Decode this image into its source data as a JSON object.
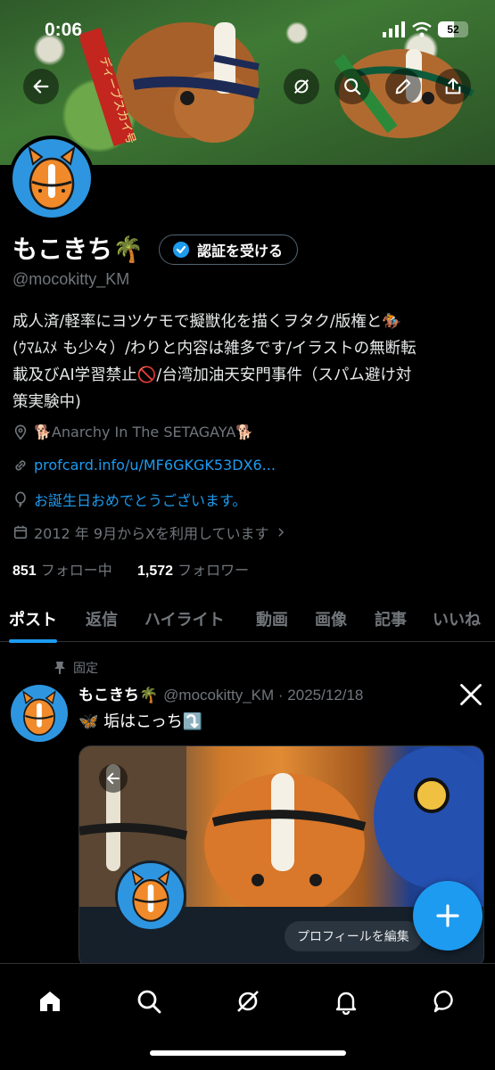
{
  "status_bar": {
    "time": "0:06",
    "battery": "52"
  },
  "banner": {
    "sash_text": "ディープスカイ号",
    "icons": [
      "back-arrow-icon",
      "grok-icon",
      "search-icon",
      "edit-pencil-icon",
      "share-icon"
    ]
  },
  "profile": {
    "name": "もこきち🌴",
    "verify_label": "認証を受ける",
    "handle": "@mocokitty_KM",
    "bio_lines": [
      "成人済/軽率にヨツケモで擬獣化を描くヲタク/版権と🏇",
      "(ｳﾏﾑｽﾒ も少々）/わりと内容は雑多です/イラストの無断転",
      "載及びAI学習禁止🚫/台湾加油天安門事件（スパム避け対",
      "策実験中)"
    ],
    "location": "🐕Anarchy In The SETAGAYA🐕",
    "link": "profcard.info/u/MF6GKGK53DX6...",
    "birthday": "お誕生日おめでとうございます。",
    "joined": "2012 年 9月からXを利用しています",
    "following_count": "851",
    "following_label": "フォロー中",
    "followers_count": "1,572",
    "followers_label": "フォロワー"
  },
  "tabs": [
    "ポスト",
    "返信",
    "ハイライト",
    "動画",
    "画像",
    "記事",
    "いいね"
  ],
  "post": {
    "pinned_label": "固定",
    "author": "もこきち🌴",
    "handle_date": "@mocokitty_KM · 2025/12/18",
    "text": "🦋 垢はこっち⤵️",
    "media_button": "プロフィールを編集"
  },
  "colors": {
    "accent": "#1d9bf0",
    "background": "#000000",
    "muted": "#71767b",
    "avatar_bg": "#2e96e0"
  }
}
